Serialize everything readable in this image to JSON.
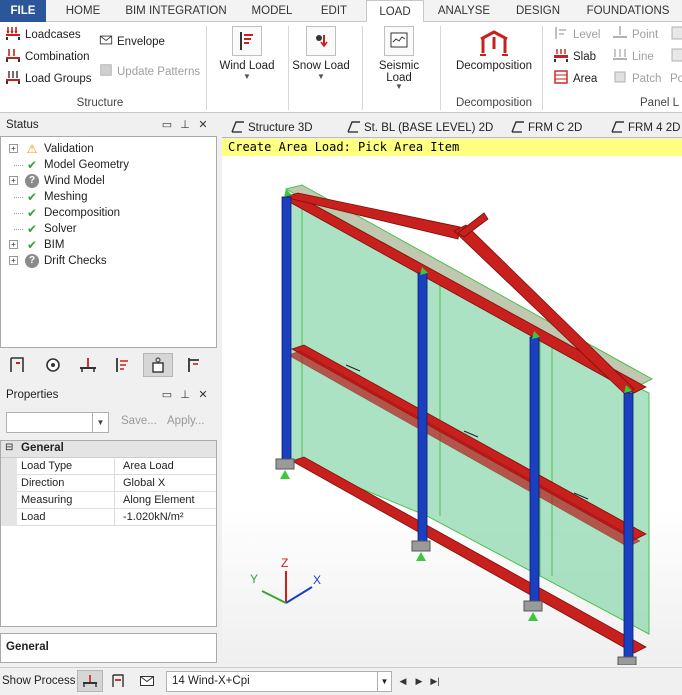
{
  "ribbon_tabs": [
    "FILE",
    "HOME",
    "BIM INTEGRATION",
    "MODEL",
    "EDIT",
    "LOAD",
    "ANALYSE",
    "DESIGN",
    "FOUNDATIONS"
  ],
  "active_tab": "LOAD",
  "ribbon": {
    "structure": {
      "loadcases": "Loadcases",
      "combination": "Combination",
      "load_groups": "Load Groups",
      "envelope": "Envelope",
      "update_patterns": "Update Patterns",
      "group_label": "Structure"
    },
    "wind_load": "Wind Load",
    "snow_load": "Snow Load",
    "seismic_load_1": "Seismic",
    "seismic_load_2": "Load",
    "decomposition": "Decomposition",
    "decomposition_group_label": "Decomposition",
    "panel": {
      "level": "Level",
      "slab": "Slab",
      "area": "Area",
      "point": "Point",
      "line": "Line",
      "patch": "Patch",
      "po": "Po",
      "group_label": "Panel L"
    }
  },
  "status_panel": {
    "title": "Status",
    "items": [
      {
        "label": "Validation",
        "icon": "warning-icon",
        "expandable": true
      },
      {
        "label": "Model Geometry",
        "icon": "check-icon",
        "expandable": false
      },
      {
        "label": "Wind Model",
        "icon": "question-icon",
        "expandable": true
      },
      {
        "label": "Meshing",
        "icon": "check-icon",
        "expandable": false
      },
      {
        "label": "Decomposition",
        "icon": "check-icon",
        "expandable": false
      },
      {
        "label": "Solver",
        "icon": "check-icon",
        "expandable": false
      },
      {
        "label": "BIM",
        "icon": "check-icon",
        "expandable": true
      },
      {
        "label": "Drift Checks",
        "icon": "question-icon",
        "expandable": true
      }
    ]
  },
  "properties_panel": {
    "title": "Properties",
    "save_label": "Save...",
    "apply_label": "Apply...",
    "category": "General",
    "rows": [
      {
        "key": "Load Type",
        "value": "Area Load"
      },
      {
        "key": "Direction",
        "value": "Global X"
      },
      {
        "key": "Measuring",
        "value": "Along Element"
      },
      {
        "key": "Load",
        "value": "-1.020kN/m²"
      }
    ],
    "description_title": "General"
  },
  "view_tabs": [
    "Structure 3D",
    "St. BL (BASE LEVEL) 2D",
    "FRM C 2D",
    "FRM 4 2D"
  ],
  "prompt_text": "Create Area Load: Pick Area Item",
  "axes": {
    "x": "X",
    "y": "Y",
    "z": "Z"
  },
  "bottom_bar": {
    "show_process_label": "Show Process",
    "loadcase_value": "14 Wind-X+Cpi"
  },
  "colors": {
    "file_tab": "#2b579a",
    "column_blue": "#1a3fbf",
    "beam_red": "#c8201c",
    "panel_green": "#7fd1a8",
    "prompt_yellow": "#ffff80"
  }
}
